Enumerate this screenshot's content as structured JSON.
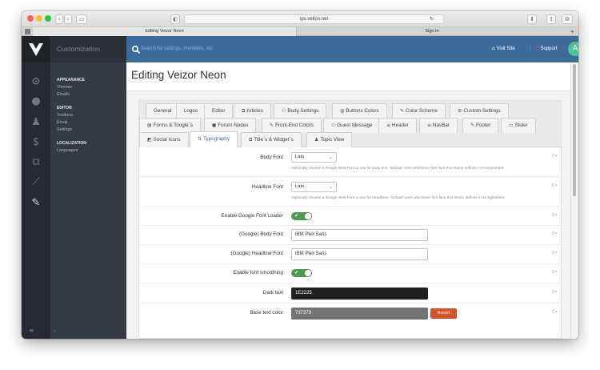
{
  "browser": {
    "url": "ips.veilon.net",
    "tabs": [
      "Editing Veizor Neon",
      "Sign In"
    ]
  },
  "sidebar": {
    "title": "Customization",
    "groups": [
      {
        "label": "APPEARANCE",
        "items": [
          "Themes",
          "Emails"
        ]
      },
      {
        "label": "EDITOR",
        "items": [
          "Toolbars",
          "Emoji",
          "Settings"
        ]
      },
      {
        "label": "LOCALIZATION",
        "items": [
          "Languages"
        ]
      }
    ],
    "rail_icons": [
      "gears-icon",
      "chat-icon",
      "user-icon",
      "dollar-icon",
      "clone-icon",
      "chart-icon",
      "brush-icon"
    ]
  },
  "topbar": {
    "search_placeholder": "Search for settings, members, etc.",
    "visit_site": "Visit Site",
    "support": "Support",
    "avatar_letter": "A"
  },
  "page": {
    "title": "Editing Veizor Neon"
  },
  "tabs": {
    "row1": [
      "General",
      "Logos",
      "Editor",
      "Articles",
      "Body Settings",
      "Buttons Colors",
      "Color Scheme",
      "Custom Settings"
    ],
    "row2": [
      "Forms & Toogle`s",
      "Forum Nodes",
      "Front-End Colors",
      "Guest Message",
      "Header",
      "NavBar",
      "Footer",
      "Slider"
    ],
    "row3": [
      "Social Icons",
      "Typography",
      "Title`s & Widget`s",
      "Topic View"
    ],
    "active": "Typography"
  },
  "settings": {
    "body_font": {
      "label": "Body Font",
      "value": "Lato",
      "desc": "Optionally choose a Google Web Font to use for body text. 'Default' uses whichever font face this theme defines in its stylesheet."
    },
    "headline_font": {
      "label": "Headline Font",
      "value": "Lato",
      "desc": "Optionally choose a Google Web Font to use for headlines. 'Default' uses whichever font face this theme defines in its stylesheet."
    },
    "google_loader": {
      "label": "Enable Google Font Loader"
    },
    "google_body": {
      "label": "(Google) Body Font",
      "value": "IBM Plex Sans"
    },
    "google_headline": {
      "label": "(Google) Headline Font",
      "value": "IBM Plex Sans"
    },
    "smoothing": {
      "label": "Enable font smoothing"
    },
    "dark_text": {
      "label": "Dark text",
      "value": "1E2225"
    },
    "base_text": {
      "label": "Base text color",
      "value": "737373",
      "revert": "Revert"
    }
  },
  "colors": {
    "accent": "#3e6b99",
    "sidebar": "#353b42",
    "rail": "#262b31",
    "toggle_on": "#4f9a4e",
    "revert": "#d2542a",
    "avatar": "#4ec09a"
  }
}
